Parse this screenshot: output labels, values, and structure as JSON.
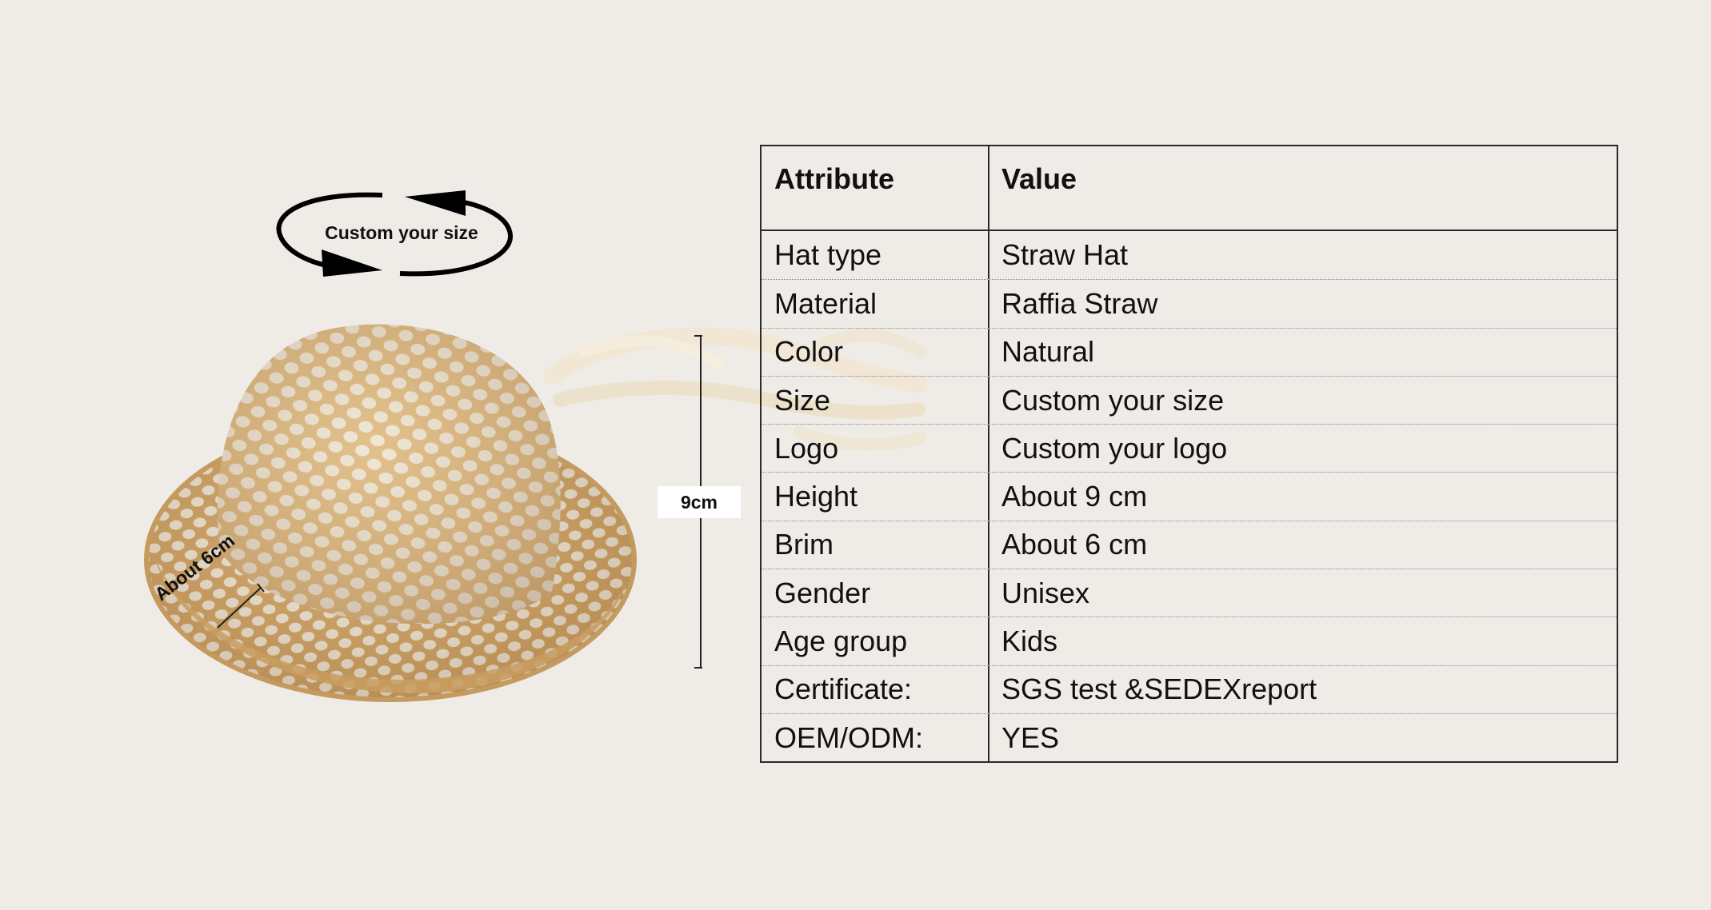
{
  "illustration": {
    "custom_size_label": "Custom your size",
    "height_label": "9cm",
    "brim_label": "About  6cm"
  },
  "table": {
    "header": {
      "attribute": "Attribute",
      "value": "Value"
    },
    "rows": [
      {
        "attribute": "Hat type",
        "value": "Straw Hat"
      },
      {
        "attribute": "Material",
        "value": "Raffia Straw"
      },
      {
        "attribute": "Color",
        "value": "Natural"
      },
      {
        "attribute": "Size",
        "value": "Custom your size"
      },
      {
        "attribute": "Logo",
        "value": "Custom your logo"
      },
      {
        "attribute": "Height",
        "value": "About 9 cm"
      },
      {
        "attribute": "Brim",
        "value": "About 6 cm"
      },
      {
        "attribute": "Gender",
        "value": "Unisex"
      },
      {
        "attribute": "Age group",
        "value": "Kids"
      },
      {
        "attribute": "Certificate:",
        "value": "SGS test &SEDEXreport"
      },
      {
        "attribute": "OEM/ODM:",
        "value": "YES"
      }
    ]
  },
  "colors": {
    "background": "#efece7",
    "straw": "#d9b47c",
    "ribbon": "#efe6d2"
  }
}
